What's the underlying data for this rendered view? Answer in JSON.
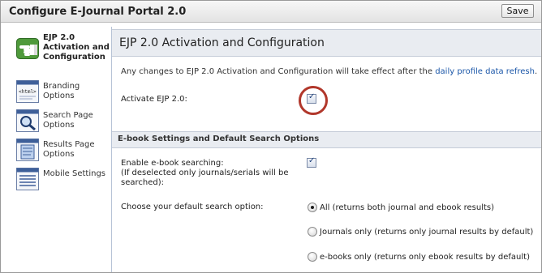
{
  "window": {
    "title": "Configure E-Journal Portal 2.0",
    "save_label": "Save"
  },
  "sidebar": {
    "items": [
      {
        "label": "EJP 2.0 Activation and Configuration",
        "icon": "pointing-hand-icon",
        "active": true
      },
      {
        "label": "Branding Options",
        "icon": "html-code-icon",
        "active": false
      },
      {
        "label": "Search Page Options",
        "icon": "magnifier-page-icon",
        "active": false
      },
      {
        "label": "Results Page Options",
        "icon": "results-page-icon",
        "active": false
      },
      {
        "label": "Mobile Settings",
        "icon": "mobile-settings-icon",
        "active": false
      }
    ]
  },
  "main": {
    "section_title": "EJP 2.0 Activation and Configuration",
    "notice_text": "Any changes to EJP 2.0 Activation and Configuration will take effect after the ",
    "notice_link": "daily profile data refresh",
    "notice_end": ".",
    "activate_label": "Activate EJP 2.0:",
    "activate_checked": true,
    "ebook_section_title": "E-book Settings and Default Search Options",
    "ebook_enable_label": "Enable e-book searching:",
    "ebook_enable_note": "(If deselected only journals/serials will be searched):",
    "ebook_enable_checked": true,
    "default_search_label": "Choose your default search option:",
    "search_options": [
      {
        "label": "All (returns both journal and ebook results)",
        "selected": true
      },
      {
        "label": "Journals only (returns only journal results by default)",
        "selected": false
      },
      {
        "label": "e-books only (returns only ebook results by default)",
        "selected": false
      }
    ]
  },
  "colors": {
    "highlight_circle": "#b1372b",
    "link": "#1a56a8",
    "section_header_bg": "#e9ecf1"
  }
}
